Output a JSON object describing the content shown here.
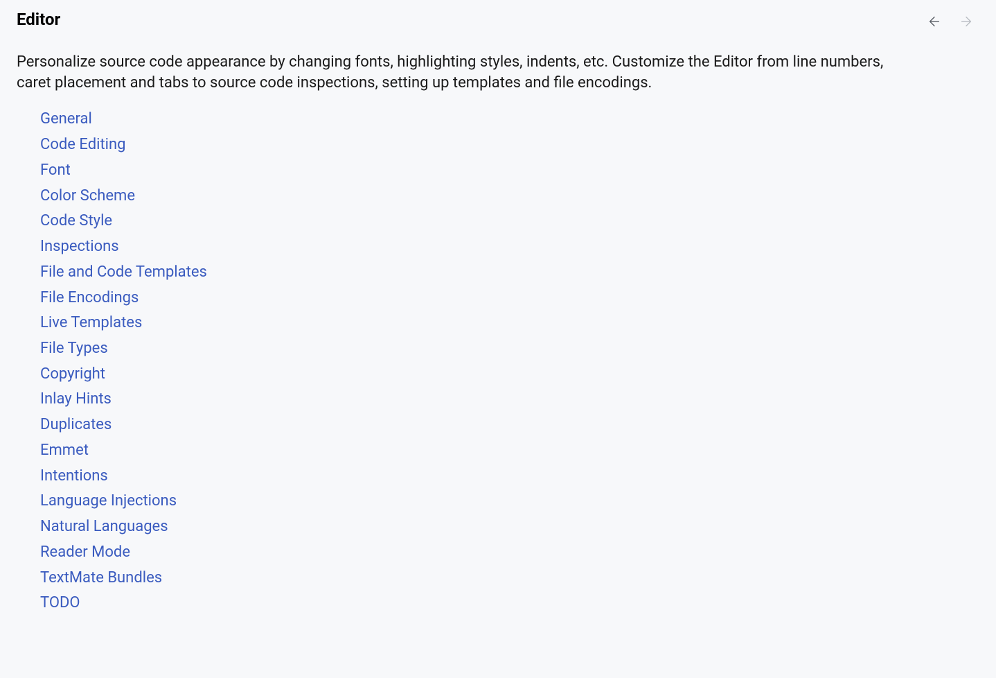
{
  "header": {
    "title": "Editor"
  },
  "description": "Personalize source code appearance by changing fonts, highlighting styles, indents, etc. Customize the Editor from line numbers, caret placement and tabs to source code inspections, setting up templates and file encodings.",
  "links": [
    "General",
    "Code Editing",
    "Font",
    "Color Scheme",
    "Code Style",
    "Inspections",
    "File and Code Templates",
    "File Encodings",
    "Live Templates",
    "File Types",
    "Copyright",
    "Inlay Hints",
    "Duplicates",
    "Emmet",
    "Intentions",
    "Language Injections",
    "Natural Languages",
    "Reader Mode",
    "TextMate Bundles",
    "TODO"
  ]
}
